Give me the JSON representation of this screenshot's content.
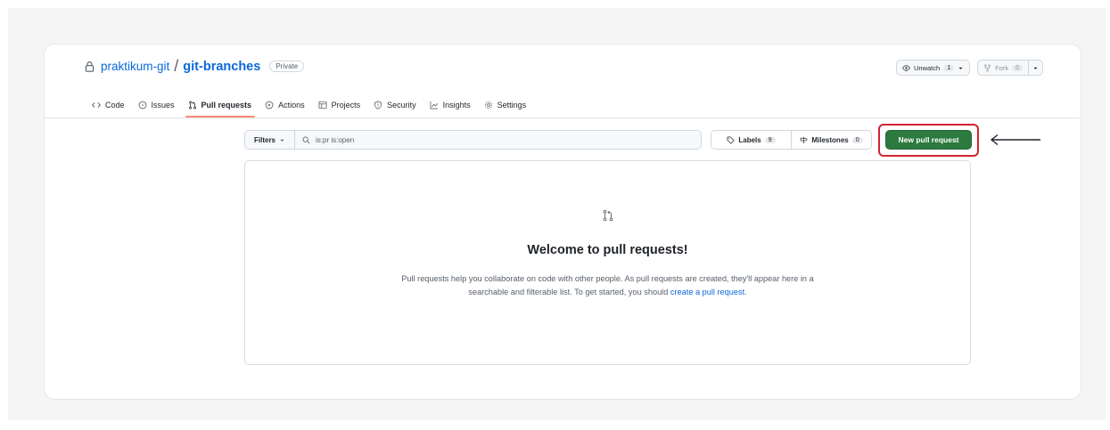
{
  "repo": {
    "owner": "praktikum-git",
    "separator": "/",
    "name": "git-branches",
    "visibility": "Private",
    "icon": "lock-icon"
  },
  "header_actions": {
    "unwatch_label": "Unwatch",
    "unwatch_count": "1",
    "fork_label": "Fork",
    "fork_count": "0"
  },
  "tabs": [
    {
      "label": "Code",
      "icon": "code-icon"
    },
    {
      "label": "Issues",
      "icon": "issue-opened-icon"
    },
    {
      "label": "Pull requests",
      "icon": "git-pull-request-icon",
      "active": true
    },
    {
      "label": "Actions",
      "icon": "play-icon"
    },
    {
      "label": "Projects",
      "icon": "table-icon"
    },
    {
      "label": "Security",
      "icon": "shield-icon"
    },
    {
      "label": "Insights",
      "icon": "graph-icon"
    },
    {
      "label": "Settings",
      "icon": "gear-icon"
    }
  ],
  "toolbar": {
    "filters_label": "Filters",
    "search_value": "is:pr is:open",
    "labels_label": "Labels",
    "labels_count": "9",
    "milestones_label": "Milestones",
    "milestones_count": "0",
    "new_pr_label": "New pull request"
  },
  "blankslate": {
    "title": "Welcome to pull requests!",
    "text_before": "Pull requests help you collaborate on code with other people. As pull requests are created, they'll appear here in a searchable and filterable list. To get started, you should ",
    "link_text": "create a pull request",
    "text_after": "."
  },
  "colors": {
    "accent_link": "#0969da",
    "primary_button": "#2c7a3e",
    "highlight_border": "#d1242f",
    "active_tab_underline": "#fd8c73"
  }
}
